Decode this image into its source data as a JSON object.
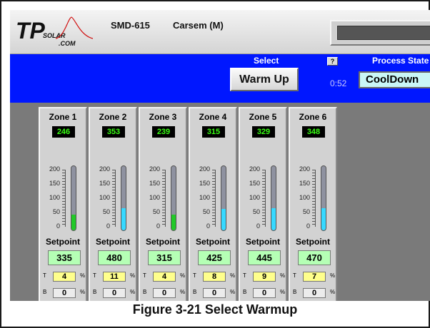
{
  "header": {
    "logo_text": "TPSOLAR.COM",
    "machine": "SMD-615",
    "location": "Carsem (M)"
  },
  "control_bar": {
    "select_label": "Select",
    "warm_up_button": "Warm Up",
    "help_label": "?",
    "timer": "0:52",
    "process_state_label": "Process State",
    "process_state_value": "CoolDown"
  },
  "scale_ticks": [
    "200",
    "150",
    "100",
    "50",
    "0"
  ],
  "bar_colors": {
    "green": "#22c928",
    "cyan": "#37d9ff"
  },
  "setpoint_label": "Setpoint",
  "pct_letters": {
    "top": "T",
    "bottom": "B",
    "percent": "%"
  },
  "zones": [
    {
      "name": "Zone 1",
      "temp": "246",
      "level": 0.24,
      "color": "green",
      "setpoint": "335",
      "t_pct": "4",
      "b_pct": "0"
    },
    {
      "name": "Zone 2",
      "temp": "353",
      "level": 0.35,
      "color": "cyan",
      "setpoint": "480",
      "t_pct": "11",
      "b_pct": "0"
    },
    {
      "name": "Zone 3",
      "temp": "239",
      "level": 0.24,
      "color": "green",
      "setpoint": "315",
      "t_pct": "4",
      "b_pct": "0"
    },
    {
      "name": "Zone 4",
      "temp": "315",
      "level": 0.33,
      "color": "cyan",
      "setpoint": "425",
      "t_pct": "8",
      "b_pct": "0"
    },
    {
      "name": "Zone 5",
      "temp": "329",
      "level": 0.34,
      "color": "cyan",
      "setpoint": "445",
      "t_pct": "9",
      "b_pct": "0"
    },
    {
      "name": "Zone 6",
      "temp": "348",
      "level": 0.35,
      "color": "cyan",
      "setpoint": "470",
      "t_pct": "7",
      "b_pct": "0"
    }
  ],
  "caption": "Figure 3-21  Select Warmup"
}
